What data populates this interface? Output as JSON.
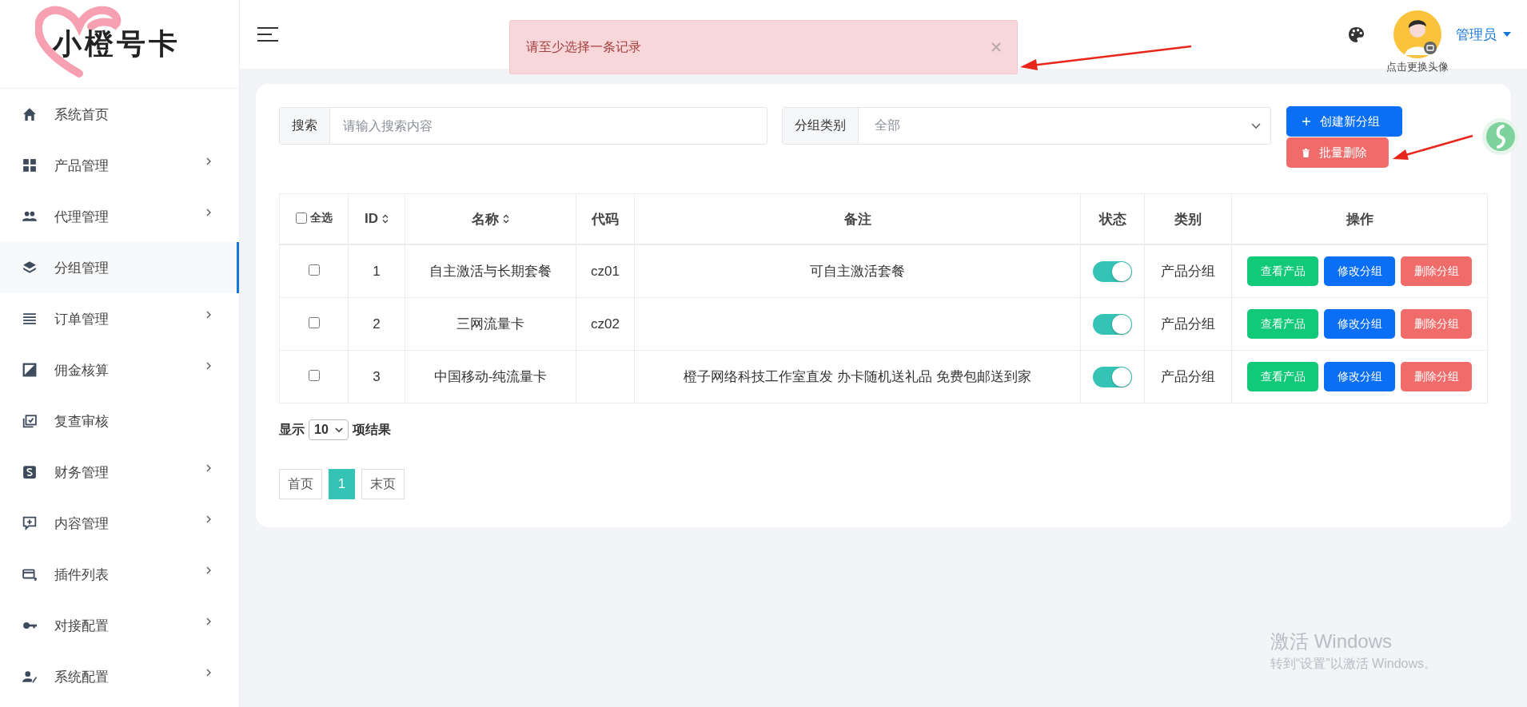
{
  "logo": {
    "text": "小橙号卡"
  },
  "sidebar": {
    "items": [
      {
        "label": "系统首页",
        "has_submenu": false,
        "selected": false
      },
      {
        "label": "产品管理",
        "has_submenu": true,
        "selected": false
      },
      {
        "label": "代理管理",
        "has_submenu": true,
        "selected": false
      },
      {
        "label": "分组管理",
        "has_submenu": false,
        "selected": true
      },
      {
        "label": "订单管理",
        "has_submenu": true,
        "selected": false
      },
      {
        "label": "佣金核算",
        "has_submenu": true,
        "selected": false
      },
      {
        "label": "复查审核",
        "has_submenu": false,
        "selected": false
      },
      {
        "label": "财务管理",
        "has_submenu": true,
        "selected": false
      },
      {
        "label": "内容管理",
        "has_submenu": true,
        "selected": false
      },
      {
        "label": "插件列表",
        "has_submenu": true,
        "selected": false
      },
      {
        "label": "对接配置",
        "has_submenu": true,
        "selected": false
      },
      {
        "label": "系统配置",
        "has_submenu": true,
        "selected": false
      }
    ]
  },
  "header": {
    "alert": "请至少选择一条记录",
    "user": "管理员",
    "avatar_caption": "点击更换头像"
  },
  "filters": {
    "search_label": "搜索",
    "search_placeholder": "请输入搜索内容",
    "category_label": "分组类别",
    "category_value": "全部"
  },
  "actions": [
    {
      "label": "创建新分组",
      "kind": "create"
    },
    {
      "label": "批量删除",
      "kind": "delete"
    }
  ],
  "table": {
    "select_all": {
      "label": "全选",
      "checked": false
    },
    "columns": [
      {
        "label": "ID",
        "sortable": true
      },
      {
        "label": "名称",
        "sortable": true
      },
      {
        "label": "代码",
        "sortable": false
      },
      {
        "label": "备注",
        "sortable": false
      },
      {
        "label": "状态",
        "sortable": false
      },
      {
        "label": "类别",
        "sortable": false
      },
      {
        "label": "操作",
        "sortable": false
      }
    ],
    "rows": [
      {
        "checked": false,
        "id": "1",
        "name": "自主激活与长期套餐",
        "code": "cz01",
        "note": "可自主激活套餐",
        "on": true,
        "category": "产品分组",
        "buttons": [
          "查看产品",
          "修改分组",
          "删除分组"
        ]
      },
      {
        "checked": false,
        "id": "2",
        "name": "三网流量卡",
        "code": "cz02",
        "note": "",
        "on": true,
        "category": "产品分组",
        "buttons": [
          "查看产品",
          "修改分组",
          "删除分组"
        ]
      },
      {
        "checked": false,
        "id": "3",
        "name": "中国移动-纯流量卡",
        "code": "",
        "note": "橙子网络科技工作室直发 办卡随机送礼品 免费包邮送到家",
        "on": true,
        "category": "产品分组",
        "buttons": [
          "查看产品",
          "修改分组",
          "删除分组"
        ]
      }
    ]
  },
  "page_size": {
    "prefix": "显示",
    "value": "10",
    "suffix": "项结果"
  },
  "pagination": [
    {
      "label": "首页",
      "selected": false
    },
    {
      "label": "1",
      "selected": true
    },
    {
      "label": "末页",
      "selected": false
    }
  ],
  "os_notice": {
    "title": "激活 Windows",
    "subtitle": "转到“设置”以激活 Windows。"
  }
}
